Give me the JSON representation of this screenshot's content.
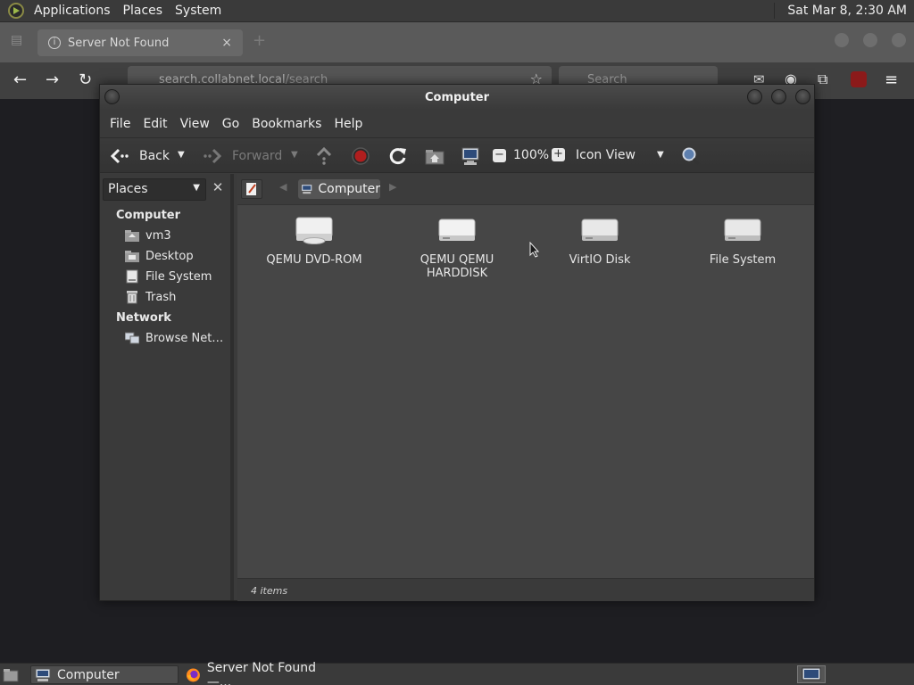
{
  "top_panel": {
    "menus": [
      "Applications",
      "Places",
      "System"
    ],
    "clock": "Sat Mar  8,  2:30 AM"
  },
  "firefox": {
    "tab_title": "Server Not Found",
    "tab_close": "×",
    "url_host": "search.collabnet.local",
    "url_path": "/search",
    "search_placeholder": "Search"
  },
  "caja": {
    "title": "Computer",
    "menubar": [
      "File",
      "Edit",
      "View",
      "Go",
      "Bookmarks",
      "Help"
    ],
    "toolbar": {
      "back": "Back",
      "forward": "Forward",
      "zoom": "100%",
      "view_mode": "Icon View"
    },
    "sidebar": {
      "places_label": "Places",
      "close": "✕",
      "sections": [
        {
          "heading": "Computer",
          "items": [
            "vm3",
            "Desktop",
            "File System",
            "Trash"
          ]
        },
        {
          "heading": "Network",
          "items": [
            "Browse Net…"
          ]
        }
      ]
    },
    "pathbar": {
      "current": "Computer"
    },
    "items": [
      {
        "label": "QEMU DVD-ROM",
        "icon": "optical-drive-icon"
      },
      {
        "label": "QEMU QEMU HARDDISK",
        "icon": "harddisk-icon"
      },
      {
        "label": "VirtIO Disk",
        "icon": "harddisk-icon"
      },
      {
        "label": "File System",
        "icon": "harddisk-icon"
      }
    ],
    "status": "4 items"
  },
  "taskbar": {
    "tasks": [
      "Computer",
      "Server Not Found —..."
    ]
  },
  "colors": {
    "panel": "#3a3a3a",
    "window_bg": "#3b3b3b",
    "content_bg": "#464646",
    "desktop": "#1f1f23"
  }
}
